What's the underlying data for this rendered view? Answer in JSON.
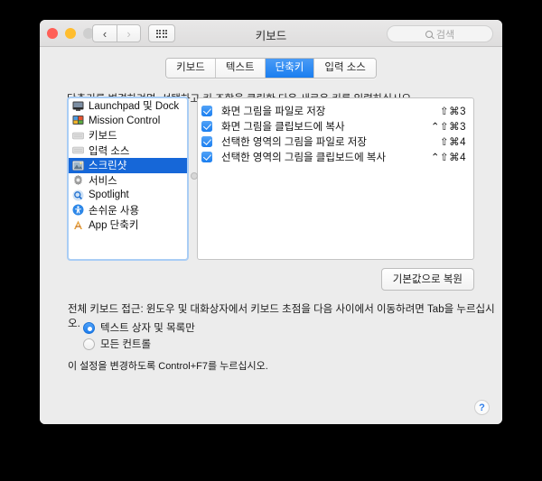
{
  "window": {
    "title": "키보드",
    "search_placeholder": "검색",
    "nav_back": "‹",
    "nav_forward": "›"
  },
  "tabs": [
    {
      "label": "키보드",
      "active": false
    },
    {
      "label": "텍스트",
      "active": false
    },
    {
      "label": "단축키",
      "active": true
    },
    {
      "label": "입력 소스",
      "active": false
    }
  ],
  "hint": "단축키를 변경하려면, 선택하고 키 조합을 클릭한 다음 새로운 키를 입력하십시오.",
  "categories": [
    {
      "label": "Launchpad 및 Dock",
      "icon": "display-dock-icon",
      "selected": false
    },
    {
      "label": "Mission Control",
      "icon": "mission-control-icon",
      "selected": false
    },
    {
      "label": "키보드",
      "icon": "keyboard-icon",
      "selected": false
    },
    {
      "label": "입력 소스",
      "icon": "input-source-icon",
      "selected": false
    },
    {
      "label": "스크린샷",
      "icon": "screenshot-icon",
      "selected": true
    },
    {
      "label": "서비스",
      "icon": "gear-icon",
      "selected": false
    },
    {
      "label": "Spotlight",
      "icon": "spotlight-icon",
      "selected": false
    },
    {
      "label": "손쉬운 사용",
      "icon": "accessibility-icon",
      "selected": false
    },
    {
      "label": "App 단축키",
      "icon": "app-shortcuts-icon",
      "selected": false
    }
  ],
  "shortcuts": [
    {
      "checked": true,
      "label": "화면 그림을 파일로 저장",
      "key": "⇧⌘3"
    },
    {
      "checked": true,
      "label": "화면 그림을 클립보드에 복사",
      "key": "⌃⇧⌘3"
    },
    {
      "checked": true,
      "label": "선택한 영역의 그림을 파일로 저장",
      "key": "⇧⌘4"
    },
    {
      "checked": true,
      "label": "선택한 영역의 그림을 클립보드에 복사",
      "key": "⌃⇧⌘4"
    }
  ],
  "restore_button": "기본값으로 복원",
  "access": {
    "description": "전체 키보드 접근: 윈도우 및 대화상자에서 키보드 초점을 다음 사이에서 이동하려면 Tab을 누르십시오.",
    "options": [
      {
        "label": "텍스트 상자 및 목록만",
        "selected": true
      },
      {
        "label": "모든 컨트롤",
        "selected": false
      }
    ],
    "footnote": "이 설정을 변경하도록 Control+F7를 누르십시오."
  },
  "help_label": "?",
  "colors": {
    "accent_blue": "#1a7ef0",
    "selection_blue": "#1667d8",
    "window_bg": "#ececec"
  }
}
